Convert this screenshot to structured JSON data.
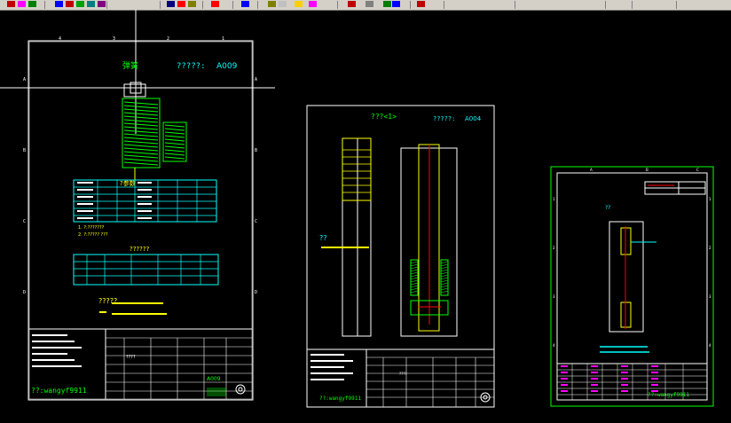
{
  "toolbar": {
    "buttons": [
      {
        "name": "text-style-icon",
        "color": "#c00000"
      },
      {
        "name": "layer-icon",
        "color": "#ff00ff"
      },
      {
        "name": "draw-icon",
        "color": "#008000"
      },
      {
        "name": "color-icon",
        "color": "#0000ff"
      },
      {
        "name": "print-icon",
        "color": "#c00000"
      },
      {
        "name": "grid-icon",
        "color": "#00a000"
      },
      {
        "name": "dimension-icon",
        "color": "#008080"
      },
      {
        "name": "zoom-icon",
        "color": "#800080"
      },
      {
        "name": "pan-icon",
        "color": "#000080"
      },
      {
        "name": "block-icon",
        "color": "#ff0000"
      },
      {
        "name": "hatch-icon",
        "color": "#808000"
      },
      {
        "name": "edit-icon",
        "color": "#ff0000"
      },
      {
        "name": "measure-icon",
        "color": "#0000ff"
      },
      {
        "name": "snap-icon",
        "color": "#808000"
      },
      {
        "name": "help-icon",
        "color": "#c0c0c0"
      },
      {
        "name": "light-icon",
        "color": "#ffd000"
      },
      {
        "name": "plot-icon",
        "color": "#ff00ff"
      },
      {
        "name": "tool-icon",
        "color": "#c00000"
      },
      {
        "name": "ruler-icon",
        "color": "#808080"
      },
      {
        "name": "shape-icon",
        "color": "#008000"
      },
      {
        "name": "window-icon",
        "color": "#0000ff"
      },
      {
        "name": "extra-icon",
        "color": "#c00000"
      }
    ]
  },
  "sheet1": {
    "title_left": "弹簧",
    "code_label": "?????:",
    "code": "A009",
    "table1_title": "?参数",
    "table2_title": "??????",
    "notes_1": "1. ?:???????",
    "notes_2": "2. ?:????? ???",
    "tech_title": "?????",
    "author": "??:wangyf9911",
    "title_block_name": "????",
    "title_block_code": "A009",
    "border_numbers": [
      "4",
      "3",
      "2",
      "1"
    ],
    "border_letters": [
      "A",
      "B",
      "C",
      "D"
    ]
  },
  "sheet2": {
    "title_left": "???<1>",
    "code_label": "?????:",
    "code": "A004",
    "side_label": "??",
    "author": "??:wangyf9911",
    "title_block_name": "????"
  },
  "sheet3": {
    "title_left": "??",
    "author": "??:wangyf9911",
    "border_letters_top": [
      "A",
      "B",
      "C"
    ],
    "border_letters_side": [
      "1",
      "2",
      "3",
      "4"
    ]
  },
  "colors": {
    "white": "#ffffff",
    "green": "#00ff00",
    "cyan": "#00ffff",
    "yellow": "#ffff00",
    "red": "#ff0000",
    "magenta": "#ff00ff"
  }
}
